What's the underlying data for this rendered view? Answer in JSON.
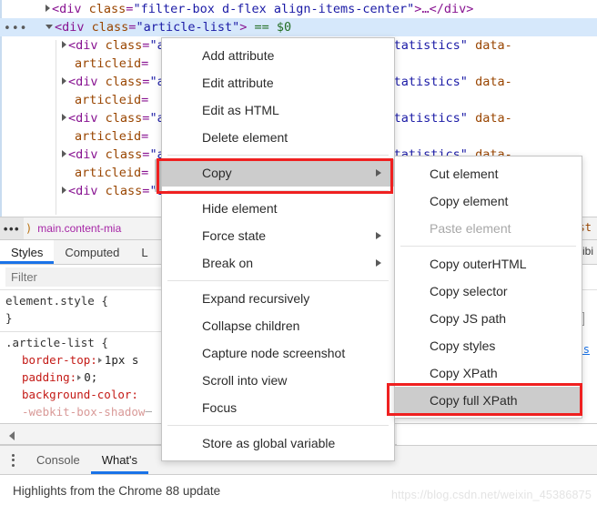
{
  "dom_tree": {
    "rows": [
      {
        "indent": "ind1",
        "arrow": "collapsed",
        "text": "<div class=\"filter-box d-flex align-items-center\">…</div>",
        "selected": false
      },
      {
        "indent": "ind1",
        "arrow": "expanded",
        "text": "<div class=\"article-list\"> == $0",
        "selected": true
      },
      {
        "indent": "ind2",
        "arrow": "collapsed",
        "text": "<div class=\"article-item-box csdn-tracking-statistics\" data-",
        "selected": false
      },
      {
        "indent": "ind2w",
        "arrow": "none",
        "text": "articleid=",
        "selected": false
      },
      {
        "indent": "ind2",
        "arrow": "collapsed",
        "text": "<div class=\"article-item-box csdn-tracking-statistics\" data-",
        "selected": false
      },
      {
        "indent": "ind2w",
        "arrow": "none",
        "text": "articleid=",
        "selected": false
      },
      {
        "indent": "ind2",
        "arrow": "collapsed",
        "text": "<div class=\"article-item-box csdn-tracking-statistics\" data-",
        "selected": false
      },
      {
        "indent": "ind2w",
        "arrow": "none",
        "text": "articleid=",
        "selected": false
      },
      {
        "indent": "ind2",
        "arrow": "collapsed",
        "text": "<div class=\"article-item-box csdn-tracking-statistics\" data-",
        "selected": false
      },
      {
        "indent": "ind2w",
        "arrow": "none",
        "text": "articleid=",
        "selected": false
      },
      {
        "indent": "ind2",
        "arrow": "collapsed",
        "text": "<div class=\"article-item-box csdn-tracking-statistics\" data-",
        "selected": false
      }
    ],
    "ellipsis_badge": "•••"
  },
  "breadcrumb": {
    "dots": "•••",
    "paren": ")",
    "item": "main.content-mia",
    "right_fragment": "list"
  },
  "sidebar_tabs": {
    "tabs": [
      {
        "label": "Styles",
        "active": true
      },
      {
        "label": "Computed",
        "active": false
      },
      {
        "label": "L",
        "active": false
      }
    ],
    "right_fragment": "ssibi"
  },
  "filter": {
    "placeholder": "Filter",
    "value": ""
  },
  "styles": {
    "rules": [
      {
        "selector": "element.style {",
        "close": "}",
        "declarations": []
      },
      {
        "selector": ".article-list {",
        "close": "",
        "declarations": [
          {
            "property": "border-top:",
            "value": "1px s",
            "disclosure": true,
            "struck": false
          },
          {
            "property": "padding:",
            "value": "0;",
            "disclosure": true,
            "struck": false
          },
          {
            "property": "background-color:",
            "value": "",
            "disclosure": false,
            "struck": false
          },
          {
            "property": "-webkit-box-shadow",
            "value": "",
            "disclosure": false,
            "struck": true
          }
        ]
      }
    ],
    "css_link": "css"
  },
  "context_menu": {
    "groups": [
      {
        "items": [
          {
            "label": "Add attribute",
            "submenu": false,
            "disabled": false,
            "hovered": false
          },
          {
            "label": "Edit attribute",
            "submenu": false,
            "disabled": false,
            "hovered": false
          },
          {
            "label": "Edit as HTML",
            "submenu": false,
            "disabled": false,
            "hovered": false
          },
          {
            "label": "Delete element",
            "submenu": false,
            "disabled": false,
            "hovered": false
          }
        ]
      },
      {
        "items": [
          {
            "label": "Copy",
            "submenu": true,
            "disabled": false,
            "hovered": true
          }
        ]
      },
      {
        "items": [
          {
            "label": "Hide element",
            "submenu": false,
            "disabled": false,
            "hovered": false
          },
          {
            "label": "Force state",
            "submenu": true,
            "disabled": false,
            "hovered": false
          },
          {
            "label": "Break on",
            "submenu": true,
            "disabled": false,
            "hovered": false
          }
        ]
      },
      {
        "items": [
          {
            "label": "Expand recursively",
            "submenu": false,
            "disabled": false,
            "hovered": false
          },
          {
            "label": "Collapse children",
            "submenu": false,
            "disabled": false,
            "hovered": false
          },
          {
            "label": "Capture node screenshot",
            "submenu": false,
            "disabled": false,
            "hovered": false
          },
          {
            "label": "Scroll into view",
            "submenu": false,
            "disabled": false,
            "hovered": false
          },
          {
            "label": "Focus",
            "submenu": false,
            "disabled": false,
            "hovered": false
          }
        ]
      },
      {
        "items": [
          {
            "label": "Store as global variable",
            "submenu": false,
            "disabled": false,
            "hovered": false
          }
        ]
      }
    ]
  },
  "copy_submenu": {
    "groups": [
      {
        "items": [
          {
            "label": "Cut element",
            "disabled": false,
            "hovered": false
          },
          {
            "label": "Copy element",
            "disabled": false,
            "hovered": false
          },
          {
            "label": "Paste element",
            "disabled": true,
            "hovered": false
          }
        ]
      },
      {
        "items": [
          {
            "label": "Copy outerHTML",
            "disabled": false,
            "hovered": false
          },
          {
            "label": "Copy selector",
            "disabled": false,
            "hovered": false
          },
          {
            "label": "Copy JS path",
            "disabled": false,
            "hovered": false
          },
          {
            "label": "Copy styles",
            "disabled": false,
            "hovered": false
          },
          {
            "label": "Copy XPath",
            "disabled": false,
            "hovered": false
          },
          {
            "label": "Copy full XPath",
            "disabled": false,
            "hovered": true
          }
        ]
      }
    ]
  },
  "drawer": {
    "tabs": [
      {
        "label": "Console",
        "active": false
      },
      {
        "label": "What's",
        "active": true
      }
    ],
    "content": "Highlights from the Chrome 88 update"
  },
  "watermark": "https://blog.csdn.net/weixin_45386875",
  "colors": {
    "selection_blue": "#d6e8fb",
    "accent_blue": "#1a73e8",
    "highlight_gray": "#cccccc",
    "annotation_red": "#ef2020",
    "tag_purple": "#881391",
    "attr_orange": "#994500",
    "value_blue": "#1a1aa6",
    "css_prop_red": "#c41a16"
  }
}
